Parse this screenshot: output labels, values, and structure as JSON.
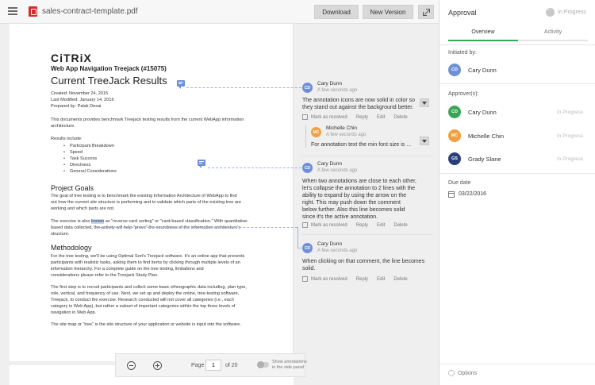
{
  "topbar": {
    "filename": "sales-contract-template.pdf",
    "download_label": "Download",
    "new_version_label": "New Version"
  },
  "document": {
    "logo": "CiTRiX",
    "subtitle": "Web App Navigation Treejack (#15075)",
    "title": "Current TreeJack Results",
    "meta": [
      "Created: November 24, 2015",
      "Last Modified: January 14, 2016",
      "Prepared by: Palak Desai"
    ],
    "intro": [
      "This documents provides benchmark Treejack testing results from the current WebApp information",
      "architecture."
    ],
    "results_label": "Results include:",
    "results": [
      "Participant Breakdown",
      "Speed",
      "Task Success",
      "Directness",
      "General Considerations"
    ],
    "goals_heading": "Project Goals",
    "goals_text": [
      "The goal of tree testing is to benchmark the existing Information Architecture of WebApp to find",
      "out how the current site structure is performing and to validate which parts of the existing tree are",
      "working and which parts are not."
    ],
    "exercise_pre": "The exercise is also ",
    "exercise_hl": "known",
    "exercise_post": " as \"reverse card sorting\" or \"card-based classification.\" With quantitative-",
    "exercise_lines": [
      "based data collected, the activity will help \"prove\" the soundness of the information architecture's",
      "structure."
    ],
    "method_heading": "Methodology",
    "method_text": [
      "For the tree testing, we'll be using Optimal Sort's Treejack software. It's an online app that presents",
      "participants with realistic tasks, asking them to find items by clicking through multiple levels of an",
      "information hierarchy. For a complete guide on the tree testing, limitations and",
      "considerations please refer to the Treejack Study Plan."
    ],
    "steps_text": [
      "The first step is to recruit participants and collect some basic ethnographic data including, plan type,",
      "role, vertical, and frequency of use. Next, we set up and deploy the online, tree-testing software,",
      "Treejack, to conduct the exercise. Research conducted will not cover all categories (i.e., each",
      "category in Web App), but rather a subset of important categories within the top three levels of",
      "navigation in Web App."
    ],
    "sitemap_text": "The site map or \"tree\" is the site structure of your application or website is input into the software."
  },
  "comments": [
    {
      "initials": "CD",
      "color": "#6f8fd8",
      "name": "Cary Dunn",
      "time": "A few seconds ago",
      "lines": [
        "The annotation icons are now solid in color so",
        "they stand out against the background better."
      ],
      "actions": [
        "Mark as resolved",
        "Reply",
        "Edit",
        "Delete"
      ]
    },
    {
      "initials": "MC",
      "color": "#f0a040",
      "name": "Michelle Chin",
      "time": "A few seconds ago",
      "lines": [
        "For annotation text the min font size is ..."
      ]
    },
    {
      "initials": "CD",
      "color": "#6f8fd8",
      "name": "Cary Dunn",
      "time": "A few seconds ago",
      "lines": [
        "When two annotations are close to each other,",
        "let's collapse the annotation to 2 lines with the",
        "ability to expand by using the arrow on the",
        "right. This may push down the comment",
        "below further. Also this line becomes solid",
        "since it's the active annotation."
      ],
      "actions": [
        "Mark as resolved",
        "Reply",
        "Edit",
        "Delete"
      ]
    },
    {
      "initials": "CD",
      "color": "#6f8fd8",
      "name": "Cary Dunn",
      "time": "A few seconds ago",
      "lines": [
        "When clicking on that comment, the line becomes",
        "solid."
      ],
      "actions": [
        "Mark as resolved",
        "Reply",
        "Edit",
        "Delete"
      ]
    }
  ],
  "pager": {
    "page_label": "Page",
    "page_value": "1",
    "of_label": "of 20",
    "toggle_label": "Show annotations in the side panel"
  },
  "panel": {
    "title": "Approval",
    "status": "In Progress",
    "tabs": [
      "Overview",
      "Activity"
    ],
    "initiated_label": "Initiated by:",
    "initiator": {
      "initials": "CD",
      "name": "Cary Dunn",
      "color": "#6f8fd8"
    },
    "approvers_label": "Approver(s):",
    "approvers": [
      {
        "initials": "CD",
        "name": "Cary Dunn",
        "color": "#3aa655",
        "state": "In Progress"
      },
      {
        "initials": "MC",
        "name": "Michelle Chin",
        "color": "#f0a040",
        "state": "In Progress"
      },
      {
        "initials": "GS",
        "name": "Grady Slane",
        "color": "#2a3f7a",
        "state": "In Progress"
      }
    ],
    "due_label": "Due date",
    "due_date": "03/22/2016",
    "options_label": "Options"
  }
}
